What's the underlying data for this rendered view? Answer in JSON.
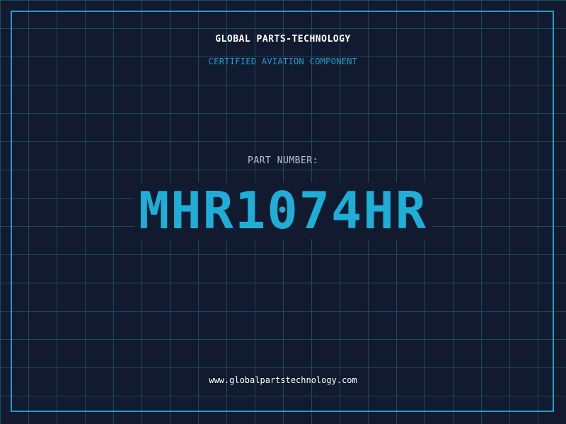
{
  "header": {
    "company_name": "GLOBAL PARTS-TECHNOLOGY",
    "tagline": "CERTIFIED AVIATION COMPONENT"
  },
  "part": {
    "label": "PART NUMBER:",
    "number": "MHR1074HR"
  },
  "footer": {
    "website": "www.globalpartstechnology.com"
  },
  "colors": {
    "background": "#111a2e",
    "grid": "#1c4a5e",
    "accent": "#1e9fcf",
    "part_number": "#1eaed8",
    "label": "#b9c3cf",
    "text": "#ffffff"
  }
}
